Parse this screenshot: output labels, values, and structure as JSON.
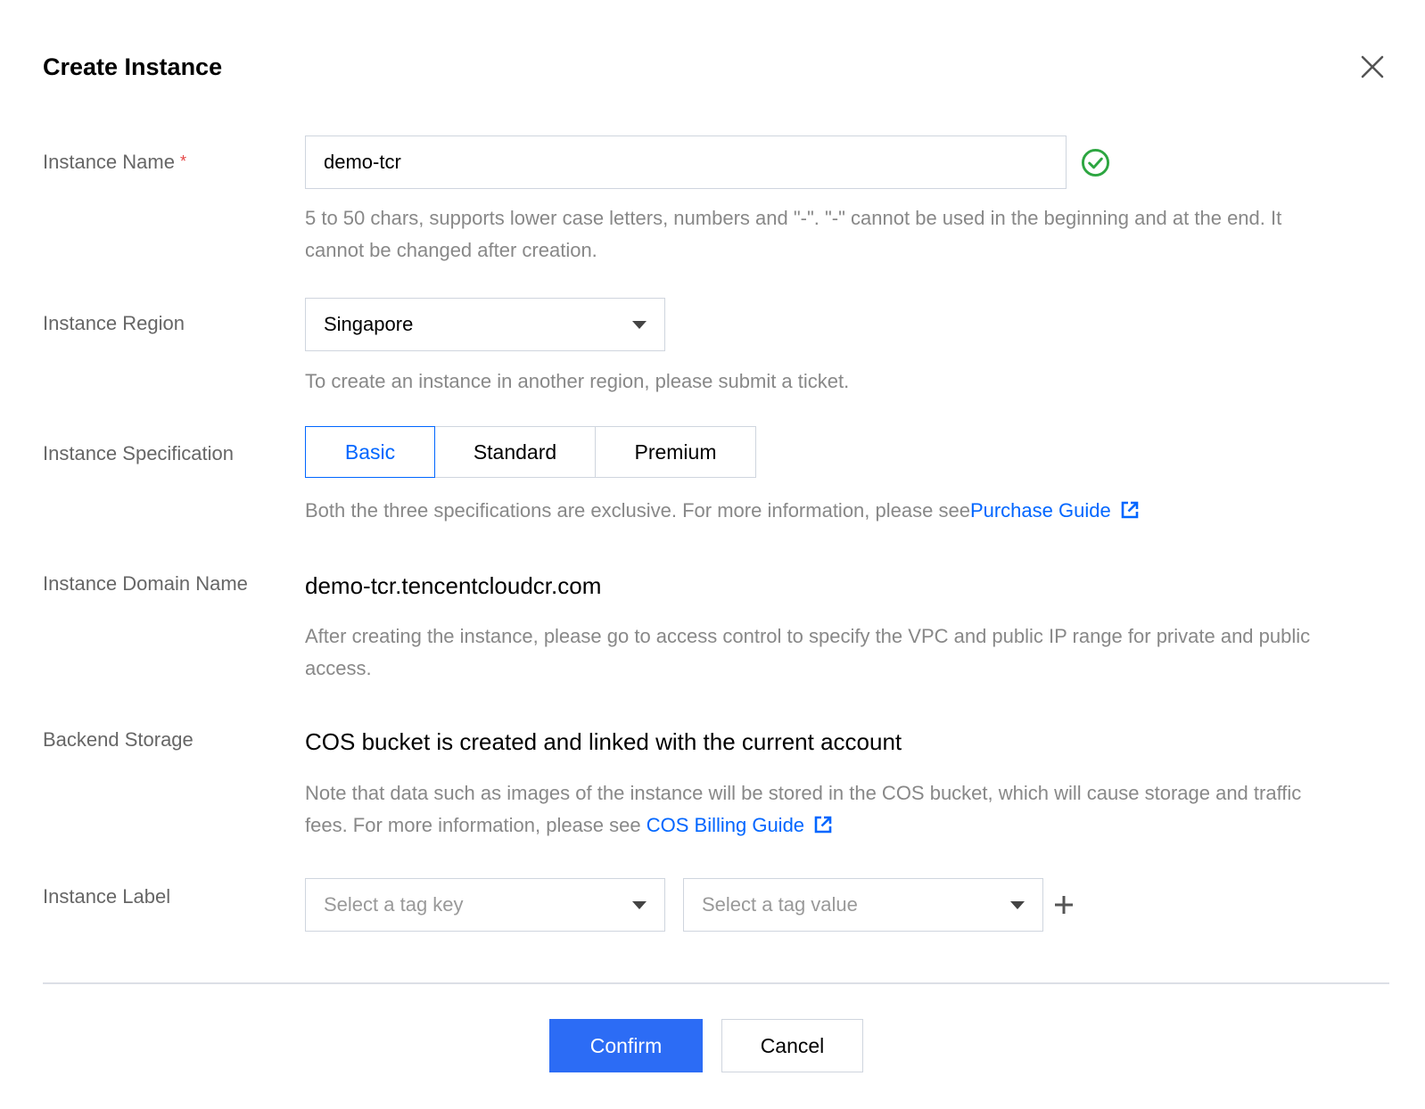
{
  "dialog": {
    "title": "Create Instance",
    "close_icon": "close-icon"
  },
  "instance_name": {
    "label": "Instance Name",
    "required_mark": "*",
    "value": "demo-tcr",
    "valid_icon": "check-circle-icon",
    "valid_color": "#2da641",
    "hint": "5 to 50 chars, supports lower case letters, numbers and \"-\". \"-\" cannot be used in the beginning and at the end. It cannot be changed after creation."
  },
  "instance_region": {
    "label": "Instance Region",
    "selected": "Singapore",
    "hint": "To create an instance in another region, please submit a ticket."
  },
  "instance_specification": {
    "label": "Instance Specification",
    "options": [
      "Basic",
      "Standard",
      "Premium"
    ],
    "selected": "Basic",
    "hint_prefix": "Both the three specifications are exclusive. For more information, please see",
    "hint_link": "Purchase Guide",
    "link_icon": "external-link-icon"
  },
  "instance_domain": {
    "label": "Instance Domain Name",
    "value": "demo-tcr.tencentcloudcr.com",
    "hint": "After creating the instance, please go to access control to specify the VPC and public IP range for private and public access."
  },
  "backend_storage": {
    "label": "Backend Storage",
    "value": "COS bucket is created and linked with the current account",
    "hint_prefix": "Note that data such as images of the instance will be stored in the COS bucket, which will cause storage and traffic fees. For more information, please see ",
    "hint_link": "COS Billing Guide",
    "link_icon": "external-link-icon"
  },
  "instance_label": {
    "label": "Instance Label",
    "tag_key_placeholder": "Select a tag key",
    "tag_value_placeholder": "Select a tag value",
    "add_icon": "plus-icon"
  },
  "footer": {
    "confirm_label": "Confirm",
    "cancel_label": "Cancel"
  },
  "colors": {
    "accent": "#0066ff",
    "primary_button": "#2c6cf5",
    "required": "#e54545"
  }
}
